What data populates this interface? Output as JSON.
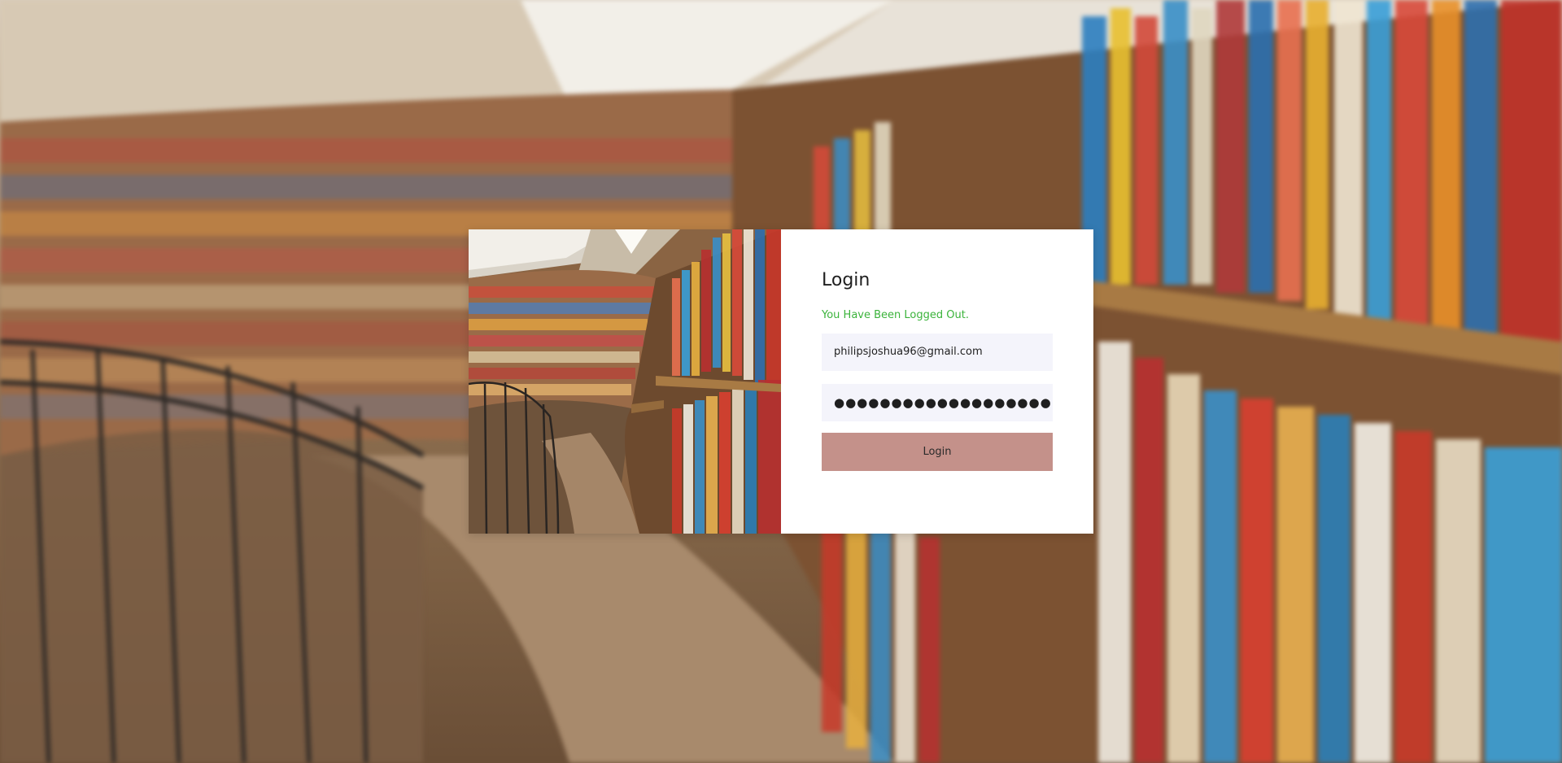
{
  "form": {
    "title": "Login",
    "message": "You Have Been Logged Out.",
    "email_value": "philipsjoshua96@gmail.com",
    "password_masked": "●●●●●●●●●●●●●●●●●●●",
    "login_label": "Login"
  },
  "colors": {
    "message": "#3bb33b",
    "button": "#c4918a",
    "field_bg": "#f4f4fb",
    "card_bg": "#ffffff"
  }
}
